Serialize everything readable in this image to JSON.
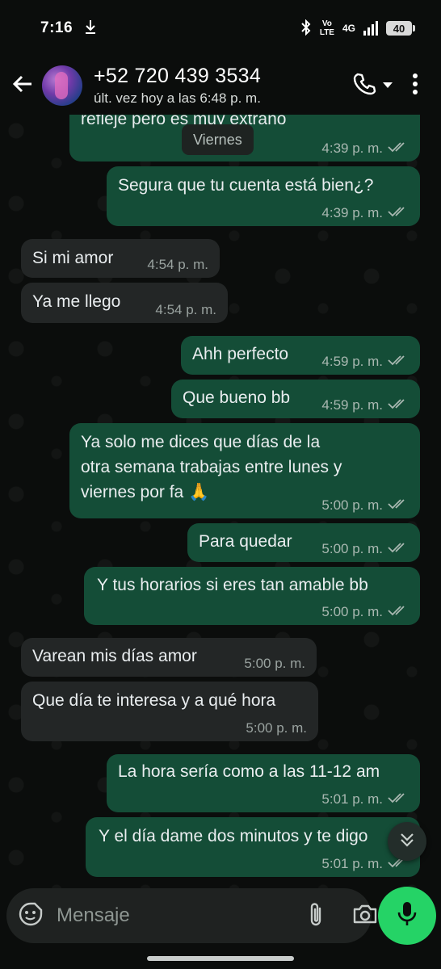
{
  "status_bar": {
    "time": "7:16",
    "network": "4G",
    "volte": "Vo\nLTE",
    "battery": "40"
  },
  "header": {
    "contact_number": "+52 720 439 3534",
    "last_seen": "últ. vez hoy a las 6:48 p. m."
  },
  "date_chip": "Viernes",
  "messages": [
    {
      "dir": "out",
      "text": "refleje pero es muy extraño",
      "time": "4:39 p. m."
    },
    {
      "dir": "out",
      "text": "Segura que tu cuenta está bien¿?",
      "time": "4:39 p. m."
    },
    {
      "dir": "in",
      "text": "Si mi amor",
      "time": "4:54 p. m."
    },
    {
      "dir": "in",
      "text": "Ya me llego",
      "time": "4:54 p. m."
    },
    {
      "dir": "out",
      "text": "Ahh perfecto",
      "time": "4:59 p. m."
    },
    {
      "dir": "out",
      "text": "Que bueno bb",
      "time": "4:59 p. m."
    },
    {
      "dir": "out",
      "text": "Ya solo me dices que días de la\notra semana trabajas entre lunes y\nviernes por fa 🙏",
      "time": "5:00 p. m."
    },
    {
      "dir": "out",
      "text": "Para quedar",
      "time": "5:00 p. m."
    },
    {
      "dir": "out",
      "text": "Y tus horarios si eres tan amable bb",
      "time": "5:00 p. m."
    },
    {
      "dir": "in",
      "text": "Varean mis días amor",
      "time": "5:00 p. m."
    },
    {
      "dir": "in",
      "text": "Que día te interesa y a qué hora",
      "time": "5:00 p. m."
    },
    {
      "dir": "out",
      "text": "La hora sería como a las 11-12 am",
      "time": "5:01 p. m."
    },
    {
      "dir": "out",
      "text": "Y el día dame dos minutos y te digo",
      "time": "5:01 p. m."
    }
  ],
  "composer": {
    "placeholder": "Mensaje"
  },
  "icons": {
    "back": "arrow-back-icon",
    "call": "phone-icon",
    "menu": "more-vert-icon",
    "sticker": "sticker-icon",
    "attach": "paperclip-icon",
    "camera": "camera-icon",
    "mic": "mic-icon",
    "scroll": "chevron-double-down-icon"
  },
  "colors": {
    "outgoing": "#144d37",
    "incoming": "#232626",
    "mic_button": "#25d366",
    "background": "#0b0d0c"
  }
}
